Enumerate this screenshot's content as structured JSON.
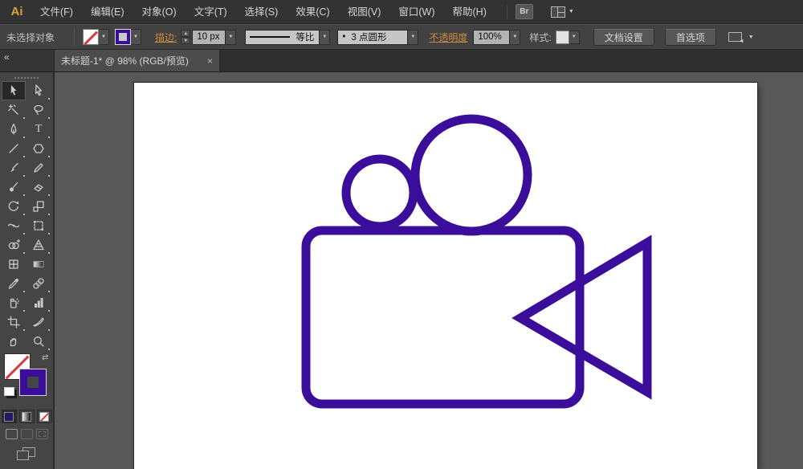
{
  "menubar": {
    "logo": "Ai",
    "items": [
      "文件(F)",
      "编辑(E)",
      "对象(O)",
      "文字(T)",
      "选择(S)",
      "效果(C)",
      "视图(V)",
      "窗口(W)",
      "帮助(H)"
    ],
    "bridge_button": "Br"
  },
  "controlbar": {
    "status": "未选择对象",
    "stroke_label": "描边:",
    "stroke_width_value": "10 px",
    "width_profile": "等比",
    "brush_dot": "•",
    "brush_name": "3 点圆形",
    "opacity_label": "不透明度",
    "opacity_value": "100%",
    "style_label": "样式:",
    "doc_setup_button": "文档设置",
    "preferences_button": "首选项",
    "dropdown_glyph": "▼"
  },
  "document_tab": {
    "title": "未标题-1* @ 98% (RGB/预览)",
    "close_glyph": "×",
    "zoom_percent": "98%",
    "color_mode": "RGB/预览"
  },
  "toolbar": {
    "collapse_glyph": "«",
    "type_tool_glyph": "T",
    "swap_glyph": "⇄",
    "tool_icons": [
      "selection-tool",
      "direct-selection-tool",
      "magic-wand-tool",
      "lasso-tool",
      "pen-tool",
      "type-tool",
      "line-segment-tool",
      "shape-tool",
      "paintbrush-tool",
      "pencil-tool",
      "blob-brush-tool",
      "eraser-tool",
      "rotate-tool",
      "scale-tool",
      "width-tool",
      "free-transform-tool",
      "shape-builder-tool",
      "perspective-grid-tool",
      "mesh-tool",
      "gradient-tool",
      "eyedropper-tool",
      "blend-tool",
      "symbol-sprayer-tool",
      "column-graph-tool",
      "artboard-tool",
      "slice-tool",
      "hand-tool",
      "zoom-tool"
    ],
    "selected_tool": "selection-tool"
  },
  "colors": {
    "stroke_purple": "#3A0D9B",
    "none_red": "#D63A3A",
    "link_orange": "#CE8A3E",
    "pasteboard_gray": "#585858",
    "artboard_white": "#FFFFFF"
  }
}
